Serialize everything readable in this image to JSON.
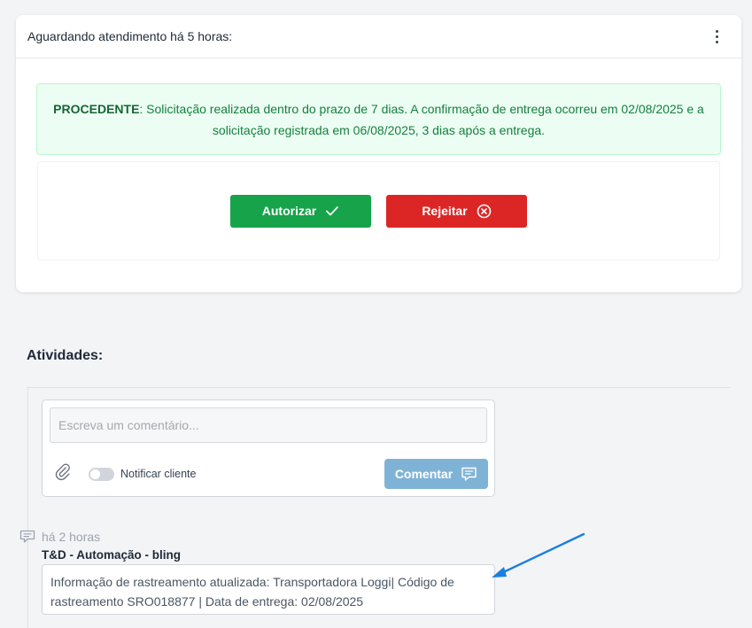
{
  "header": {
    "title": "Aguardando atendimento há 5 horas:"
  },
  "alert": {
    "status": "PROCEDENTE",
    "message": ": Solicitação realizada dentro do prazo de 7 dias. A confirmação de entrega ocorreu em 02/08/2025 e a solicitação registrada em 06/08/2025, 3 dias após a entrega."
  },
  "actions": {
    "authorize_label": "Autorizar",
    "reject_label": "Rejeitar"
  },
  "activities": {
    "title": "Atividades:",
    "comment": {
      "placeholder": "Escreva um comentário...",
      "notify_label": "Notificar cliente",
      "submit_label": "Comentar"
    },
    "items": [
      {
        "time": "há 2 horas",
        "author": "T&D - Automação - bling",
        "text": "Informação de rastreamento atualizada: Transportadora Loggi| Código de rastreamento SRO018877 | Data de entrega: 02/08/2025"
      }
    ]
  },
  "colors": {
    "success": "#16a34a",
    "danger": "#dc2626",
    "comment_button": "#7fb3d5",
    "annotation_arrow": "#1a7fe0"
  }
}
